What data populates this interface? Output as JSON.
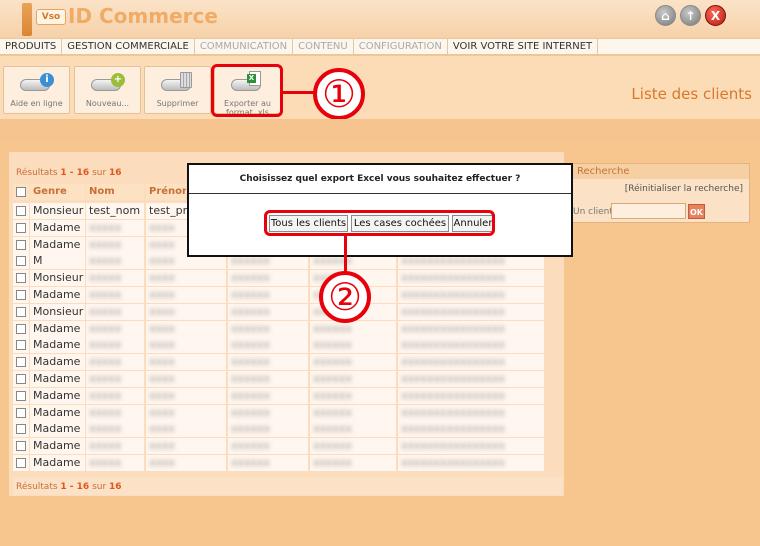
{
  "app": {
    "logo_badge": "Vso",
    "title": "ID Commerce"
  },
  "header_buttons": {
    "close_glyph": "X"
  },
  "menu": {
    "items": [
      {
        "label": "PRODUITS"
      },
      {
        "label": "GESTION COMMERCIALE"
      },
      {
        "label": "COMMUNICATION"
      },
      {
        "label": "CONTENU"
      },
      {
        "label": "CONFIGURATION"
      },
      {
        "label": "VOIR VOTRE SITE INTERNET"
      }
    ]
  },
  "toolbar": {
    "help_label": "Aide en ligne",
    "new_label": "Nouveau...",
    "delete_label": "Supprimer",
    "export_label": "Exporter au format .xls"
  },
  "page": {
    "heading": "Liste des clients"
  },
  "callouts": {
    "one": "①",
    "two": "②"
  },
  "list": {
    "results_prefix": "Résultats ",
    "results_range": "1 - 16",
    "results_of": " sur ",
    "results_total": "16",
    "columns": {
      "genre": "Genre",
      "nom": "Nom",
      "prenom": "Prénom"
    },
    "rows": [
      {
        "genre": "Monsieur",
        "nom": "test_nom",
        "prenom": "test_pre"
      },
      {
        "genre": "Madame"
      },
      {
        "genre": "Madame"
      },
      {
        "genre": "M"
      },
      {
        "genre": "Monsieur"
      },
      {
        "genre": "Madame"
      },
      {
        "genre": "Monsieur"
      },
      {
        "genre": "Madame"
      },
      {
        "genre": "Madame"
      },
      {
        "genre": "Madame"
      },
      {
        "genre": "Madame"
      },
      {
        "genre": "Madame"
      },
      {
        "genre": "Madame"
      },
      {
        "genre": "Madame"
      },
      {
        "genre": "Madame"
      },
      {
        "genre": "Madame"
      }
    ]
  },
  "search": {
    "title": "Recherche",
    "reset": "[Réinitialiser la recherche]",
    "client_label": "Un client",
    "ok": "OK"
  },
  "dialog": {
    "title": "Choisissez quel export Excel vous souhaitez effectuer ?",
    "all_clients": "Tous les clients",
    "checked": "Les cases cochées",
    "cancel": "Annuler"
  }
}
